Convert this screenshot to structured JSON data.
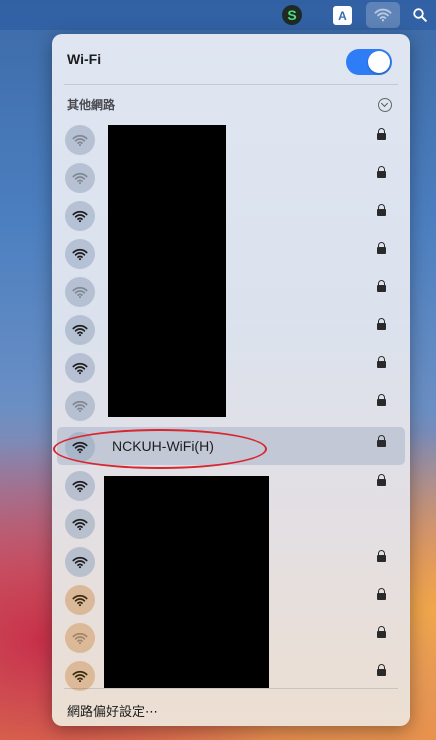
{
  "menubar": {
    "icons": [
      "s-app-icon",
      "input-source-icon",
      "wifi-icon",
      "search-icon"
    ],
    "input_source_label": "A",
    "s_app_label": "S"
  },
  "panel": {
    "title": "Wi-Fi",
    "wifi_enabled": true,
    "other_networks_label": "其他網路",
    "selected_network": "NCKUH-WiFi(H)",
    "preferences_label": "網路偏好設定⋯"
  },
  "networks": [
    {
      "name": "",
      "signal": "weak",
      "locked": true
    },
    {
      "name": "",
      "signal": "weak",
      "locked": true
    },
    {
      "name": "",
      "signal": "strong",
      "locked": true
    },
    {
      "name": "",
      "signal": "strong",
      "locked": true
    },
    {
      "name": "",
      "signal": "weak",
      "locked": true
    },
    {
      "name": "",
      "signal": "strong",
      "locked": true
    },
    {
      "name": "",
      "signal": "strong",
      "locked": true
    },
    {
      "name": "",
      "signal": "weak",
      "locked": true
    },
    {
      "name": "NCKUH-WiFi(H)",
      "signal": "strong",
      "locked": true
    },
    {
      "name": "",
      "signal": "strong",
      "locked": true
    },
    {
      "name": "",
      "signal": "strong",
      "locked": false
    },
    {
      "name": "",
      "signal": "strong",
      "locked": true
    },
    {
      "name": "",
      "signal": "strong",
      "locked": true
    },
    {
      "name": "",
      "signal": "weak",
      "locked": true
    },
    {
      "name": "",
      "signal": "strong",
      "locked": true
    }
  ],
  "colors": {
    "toggle_on": "#2f7df6",
    "highlight_circle": "#d9262f"
  }
}
